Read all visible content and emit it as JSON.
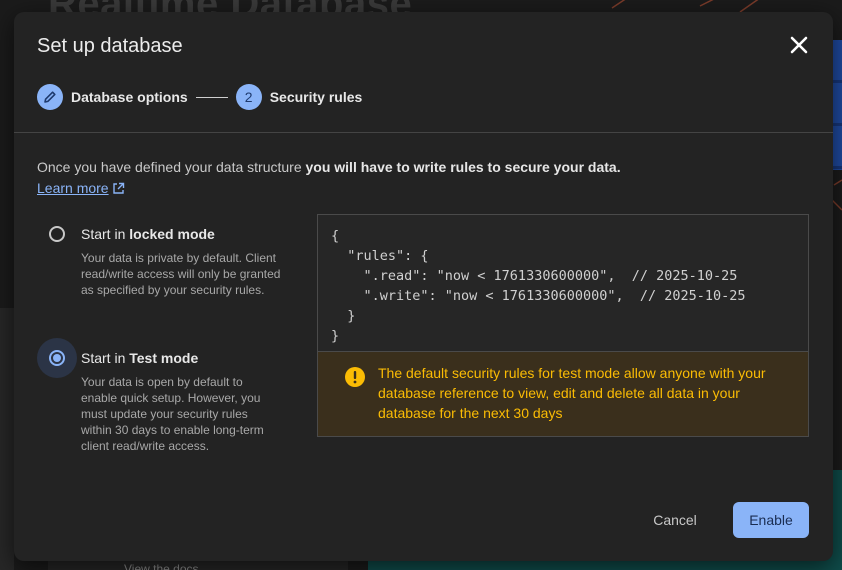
{
  "background": {
    "title": "Realtime Database",
    "docs_link": "View the docs"
  },
  "dialog": {
    "title": "Set up database",
    "close_icon": "close-icon"
  },
  "stepper": {
    "step1": {
      "label": "Database options",
      "icon": "pencil-icon"
    },
    "step2": {
      "number": "2",
      "label": "Security rules"
    }
  },
  "intro": {
    "text_plain": "Once you have defined your data structure ",
    "text_bold": "you will have to write rules to secure your data.",
    "learn_more": "Learn more",
    "learn_more_icon": "external-link-icon"
  },
  "options": {
    "locked": {
      "title_prefix": "Start in ",
      "title_bold": "locked mode",
      "description": "Your data is private by default. Client read/write access will only be granted as specified by your security rules.",
      "selected": false
    },
    "test": {
      "title_prefix": "Start in ",
      "title_bold": "Test mode",
      "description": "Your data is open by default to enable quick setup. However, you must update your security rules within 30 days to enable long-term client read/write access.",
      "selected": true
    }
  },
  "rules_code": "{\n  \"rules\": {\n    \".read\": \"now < 1761330600000\",  // 2025-10-25\n    \".write\": \"now < 1761330600000\",  // 2025-10-25\n  }\n}",
  "warning": {
    "icon": "warning-icon",
    "text": "The default security rules for test mode allow anyone with your database reference to view, edit and delete all data in your database for the next 30 days"
  },
  "actions": {
    "cancel_label": "Cancel",
    "enable_label": "Enable"
  },
  "colors": {
    "accent": "#8ab4f8",
    "warning": "#fbbc04",
    "dialog_bg": "#232323"
  }
}
